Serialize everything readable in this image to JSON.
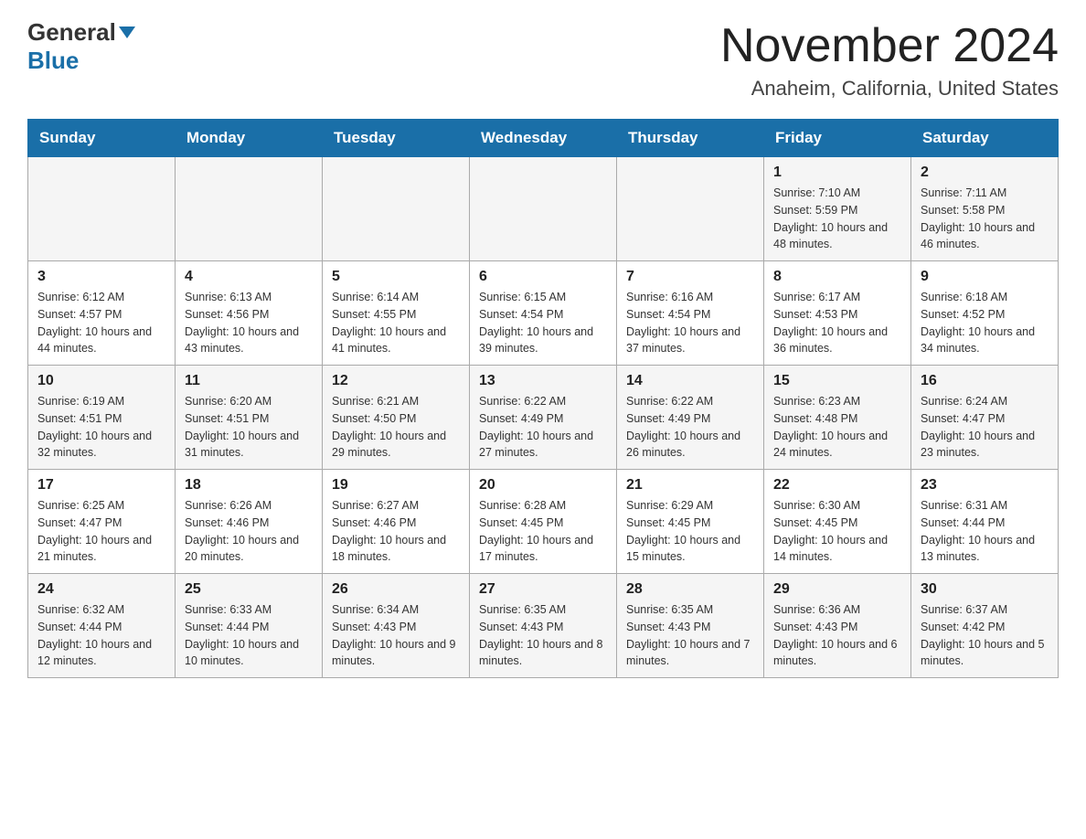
{
  "header": {
    "logo_general": "General",
    "logo_blue": "Blue",
    "month_title": "November 2024",
    "location": "Anaheim, California, United States"
  },
  "days_of_week": [
    "Sunday",
    "Monday",
    "Tuesday",
    "Wednesday",
    "Thursday",
    "Friday",
    "Saturday"
  ],
  "weeks": [
    [
      {
        "day": "",
        "info": ""
      },
      {
        "day": "",
        "info": ""
      },
      {
        "day": "",
        "info": ""
      },
      {
        "day": "",
        "info": ""
      },
      {
        "day": "",
        "info": ""
      },
      {
        "day": "1",
        "info": "Sunrise: 7:10 AM\nSunset: 5:59 PM\nDaylight: 10 hours and 48 minutes."
      },
      {
        "day": "2",
        "info": "Sunrise: 7:11 AM\nSunset: 5:58 PM\nDaylight: 10 hours and 46 minutes."
      }
    ],
    [
      {
        "day": "3",
        "info": "Sunrise: 6:12 AM\nSunset: 4:57 PM\nDaylight: 10 hours and 44 minutes."
      },
      {
        "day": "4",
        "info": "Sunrise: 6:13 AM\nSunset: 4:56 PM\nDaylight: 10 hours and 43 minutes."
      },
      {
        "day": "5",
        "info": "Sunrise: 6:14 AM\nSunset: 4:55 PM\nDaylight: 10 hours and 41 minutes."
      },
      {
        "day": "6",
        "info": "Sunrise: 6:15 AM\nSunset: 4:54 PM\nDaylight: 10 hours and 39 minutes."
      },
      {
        "day": "7",
        "info": "Sunrise: 6:16 AM\nSunset: 4:54 PM\nDaylight: 10 hours and 37 minutes."
      },
      {
        "day": "8",
        "info": "Sunrise: 6:17 AM\nSunset: 4:53 PM\nDaylight: 10 hours and 36 minutes."
      },
      {
        "day": "9",
        "info": "Sunrise: 6:18 AM\nSunset: 4:52 PM\nDaylight: 10 hours and 34 minutes."
      }
    ],
    [
      {
        "day": "10",
        "info": "Sunrise: 6:19 AM\nSunset: 4:51 PM\nDaylight: 10 hours and 32 minutes."
      },
      {
        "day": "11",
        "info": "Sunrise: 6:20 AM\nSunset: 4:51 PM\nDaylight: 10 hours and 31 minutes."
      },
      {
        "day": "12",
        "info": "Sunrise: 6:21 AM\nSunset: 4:50 PM\nDaylight: 10 hours and 29 minutes."
      },
      {
        "day": "13",
        "info": "Sunrise: 6:22 AM\nSunset: 4:49 PM\nDaylight: 10 hours and 27 minutes."
      },
      {
        "day": "14",
        "info": "Sunrise: 6:22 AM\nSunset: 4:49 PM\nDaylight: 10 hours and 26 minutes."
      },
      {
        "day": "15",
        "info": "Sunrise: 6:23 AM\nSunset: 4:48 PM\nDaylight: 10 hours and 24 minutes."
      },
      {
        "day": "16",
        "info": "Sunrise: 6:24 AM\nSunset: 4:47 PM\nDaylight: 10 hours and 23 minutes."
      }
    ],
    [
      {
        "day": "17",
        "info": "Sunrise: 6:25 AM\nSunset: 4:47 PM\nDaylight: 10 hours and 21 minutes."
      },
      {
        "day": "18",
        "info": "Sunrise: 6:26 AM\nSunset: 4:46 PM\nDaylight: 10 hours and 20 minutes."
      },
      {
        "day": "19",
        "info": "Sunrise: 6:27 AM\nSunset: 4:46 PM\nDaylight: 10 hours and 18 minutes."
      },
      {
        "day": "20",
        "info": "Sunrise: 6:28 AM\nSunset: 4:45 PM\nDaylight: 10 hours and 17 minutes."
      },
      {
        "day": "21",
        "info": "Sunrise: 6:29 AM\nSunset: 4:45 PM\nDaylight: 10 hours and 15 minutes."
      },
      {
        "day": "22",
        "info": "Sunrise: 6:30 AM\nSunset: 4:45 PM\nDaylight: 10 hours and 14 minutes."
      },
      {
        "day": "23",
        "info": "Sunrise: 6:31 AM\nSunset: 4:44 PM\nDaylight: 10 hours and 13 minutes."
      }
    ],
    [
      {
        "day": "24",
        "info": "Sunrise: 6:32 AM\nSunset: 4:44 PM\nDaylight: 10 hours and 12 minutes."
      },
      {
        "day": "25",
        "info": "Sunrise: 6:33 AM\nSunset: 4:44 PM\nDaylight: 10 hours and 10 minutes."
      },
      {
        "day": "26",
        "info": "Sunrise: 6:34 AM\nSunset: 4:43 PM\nDaylight: 10 hours and 9 minutes."
      },
      {
        "day": "27",
        "info": "Sunrise: 6:35 AM\nSunset: 4:43 PM\nDaylight: 10 hours and 8 minutes."
      },
      {
        "day": "28",
        "info": "Sunrise: 6:35 AM\nSunset: 4:43 PM\nDaylight: 10 hours and 7 minutes."
      },
      {
        "day": "29",
        "info": "Sunrise: 6:36 AM\nSunset: 4:43 PM\nDaylight: 10 hours and 6 minutes."
      },
      {
        "day": "30",
        "info": "Sunrise: 6:37 AM\nSunset: 4:42 PM\nDaylight: 10 hours and 5 minutes."
      }
    ]
  ]
}
